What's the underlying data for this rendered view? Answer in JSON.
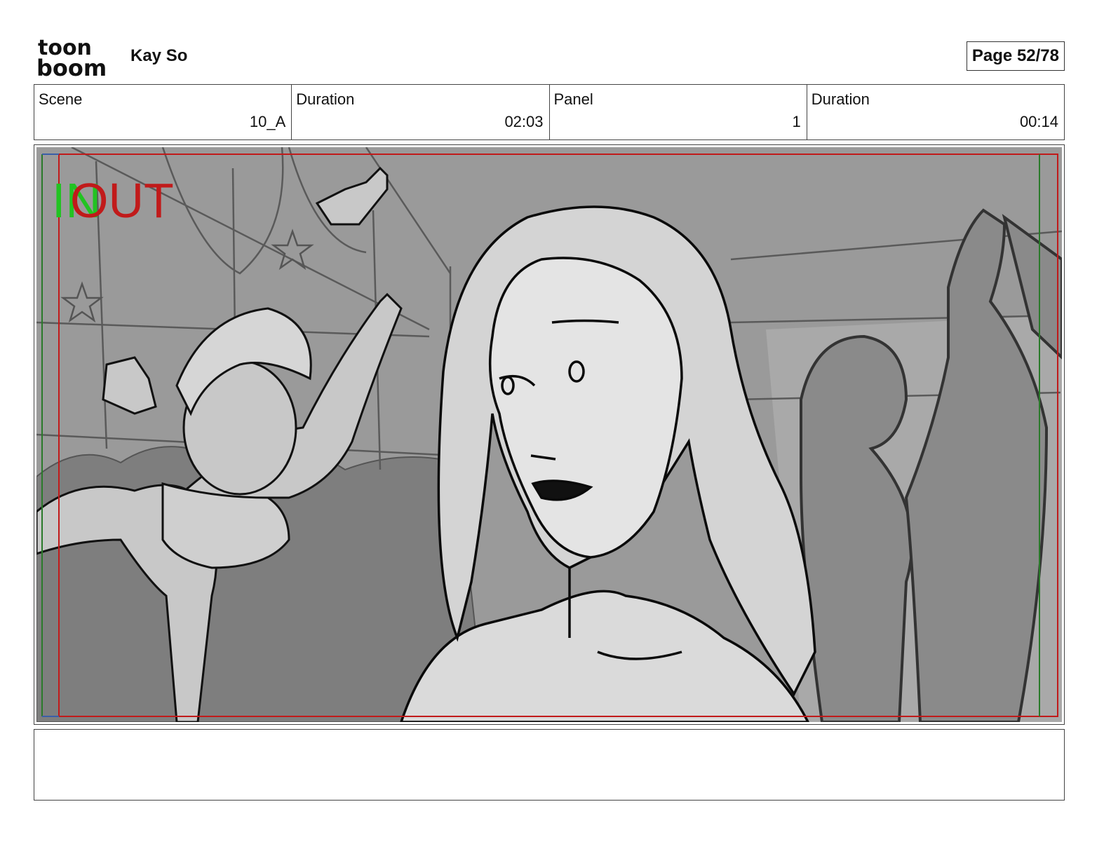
{
  "header": {
    "logo_text_top": "toon",
    "logo_text_bottom": "boom",
    "author": "Kay So",
    "page_indicator": "Page 52/78"
  },
  "info": {
    "scene_label": "Scene",
    "scene_value": "10_A",
    "scene_duration_label": "Duration",
    "scene_duration_value": "02:03",
    "panel_label": "Panel",
    "panel_value": "1",
    "panel_duration_label": "Duration",
    "panel_duration_value": "00:14"
  },
  "panel": {
    "marker_in": "IN",
    "marker_out": "OUT"
  },
  "colors": {
    "in_marker": "#22c322",
    "out_marker": "#c11a1a",
    "safe_frame": "#c11a1a",
    "title_safe": "#2a7a2a"
  },
  "notes": {
    "text": ""
  }
}
